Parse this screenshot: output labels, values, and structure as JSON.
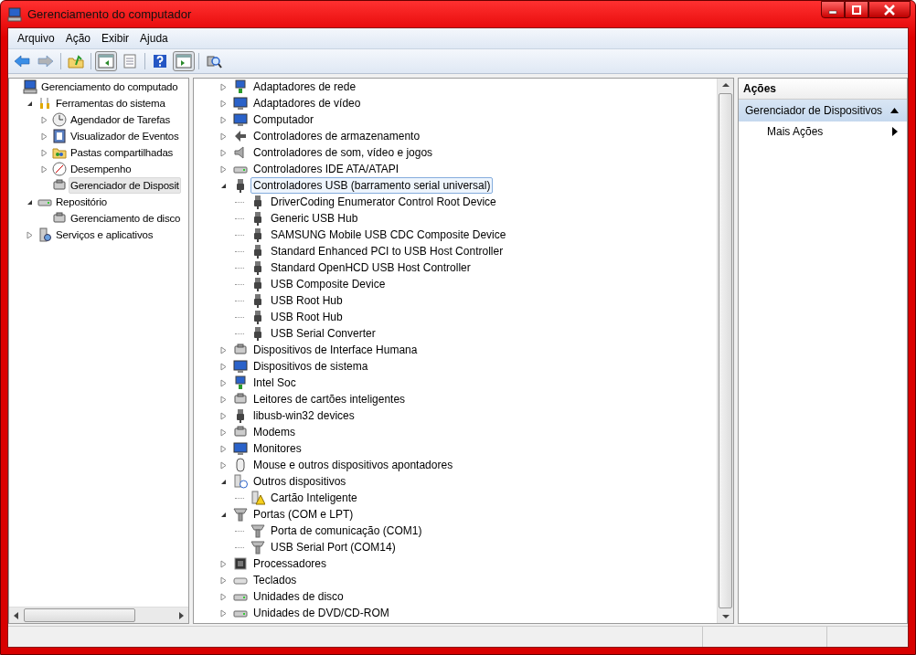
{
  "window": {
    "title": "Gerenciamento do computador"
  },
  "menu": [
    {
      "label": "Arquivo"
    },
    {
      "label": "Ação"
    },
    {
      "label": "Exibir"
    },
    {
      "label": "Ajuda"
    }
  ],
  "toolbar": [
    {
      "kind": "back",
      "disabled": false,
      "pressed": false
    },
    {
      "kind": "forward",
      "disabled": true,
      "pressed": false
    },
    {
      "kind": "up",
      "disabled": false,
      "pressed": false
    },
    {
      "kind": "tree-toggle",
      "disabled": false,
      "pressed": true
    },
    {
      "kind": "properties",
      "disabled": false,
      "pressed": false
    },
    {
      "kind": "help",
      "disabled": false,
      "pressed": false
    },
    {
      "kind": "pane-toggle",
      "disabled": false,
      "pressed": true
    },
    {
      "kind": "scan",
      "disabled": false,
      "pressed": false
    }
  ],
  "console_tree": [
    {
      "label": "Gerenciamento do computado",
      "kind": "computer",
      "selected": false,
      "children": [
        {
          "label": "Ferramentas do sistema",
          "kind": "tools",
          "expanded": true,
          "selected": false,
          "children": [
            {
              "label": "Agendador de Tarefas",
              "kind": "clock",
              "expanded": false,
              "selected": false
            },
            {
              "label": "Visualizador de Eventos",
              "kind": "log",
              "expanded": false,
              "selected": false
            },
            {
              "label": "Pastas compartilhadas",
              "kind": "folder",
              "expanded": false,
              "selected": false
            },
            {
              "label": "Desempenho",
              "kind": "gauge",
              "expanded": false,
              "selected": false
            },
            {
              "label": "Gerenciador de Disposit",
              "kind": "device",
              "selected": true
            }
          ]
        },
        {
          "label": "Repositório",
          "kind": "drive",
          "expanded": true,
          "selected": false,
          "children": [
            {
              "label": "Gerenciamento de disco",
              "kind": "device",
              "selected": false
            }
          ]
        },
        {
          "label": "Serviços e aplicativos",
          "kind": "services",
          "expanded": false,
          "selected": false
        }
      ]
    }
  ],
  "device_tree": [
    {
      "label": "Adaptadores de rede",
      "kind": "network",
      "expanded": false,
      "selected": false
    },
    {
      "label": "Adaptadores de vídeo",
      "kind": "monitor",
      "expanded": false,
      "selected": false
    },
    {
      "label": "Computador",
      "kind": "monitor",
      "expanded": false,
      "selected": false
    },
    {
      "label": "Controladores de armazenamento",
      "kind": "storage",
      "expanded": false,
      "selected": false
    },
    {
      "label": "Controladores de som, vídeo e jogos",
      "kind": "speaker",
      "expanded": false,
      "selected": false
    },
    {
      "label": "Controladores IDE ATA/ATAPI",
      "kind": "drive",
      "expanded": false,
      "selected": false
    },
    {
      "label": "Controladores USB (barramento serial universal)",
      "kind": "usb",
      "expanded": true,
      "selected": true,
      "children": [
        {
          "label": "DriverCoding Enumerator Control Root Device",
          "kind": "usb",
          "selected": false
        },
        {
          "label": "Generic USB Hub",
          "kind": "usb",
          "selected": false
        },
        {
          "label": "SAMSUNG Mobile USB CDC Composite Device",
          "kind": "usb",
          "selected": false
        },
        {
          "label": "Standard Enhanced PCI to USB Host Controller",
          "kind": "usb",
          "selected": false
        },
        {
          "label": "Standard OpenHCD USB Host Controller",
          "kind": "usb",
          "selected": false
        },
        {
          "label": "USB Composite Device",
          "kind": "usb",
          "selected": false
        },
        {
          "label": "USB Root Hub",
          "kind": "usb",
          "selected": false
        },
        {
          "label": "USB Root Hub",
          "kind": "usb",
          "selected": false
        },
        {
          "label": "USB Serial Converter",
          "kind": "usb",
          "selected": false
        }
      ]
    },
    {
      "label": "Dispositivos de Interface Humana",
      "kind": "device",
      "expanded": false,
      "selected": false
    },
    {
      "label": "Dispositivos de sistema",
      "kind": "monitor",
      "expanded": false,
      "selected": false
    },
    {
      "label": "Intel Soc",
      "kind": "network",
      "expanded": false,
      "selected": false
    },
    {
      "label": "Leitores de cartões inteligentes",
      "kind": "device",
      "expanded": false,
      "selected": false
    },
    {
      "label": "libusb-win32 devices",
      "kind": "usb",
      "expanded": false,
      "selected": false
    },
    {
      "label": "Modems",
      "kind": "device",
      "expanded": false,
      "selected": false
    },
    {
      "label": "Monitores",
      "kind": "monitor",
      "expanded": false,
      "selected": false
    },
    {
      "label": "Mouse e outros dispositivos apontadores",
      "kind": "mouse",
      "expanded": false,
      "selected": false
    },
    {
      "label": "Outros dispositivos",
      "kind": "unknown",
      "expanded": true,
      "selected": false,
      "children": [
        {
          "label": "Cartão Inteligente",
          "kind": "warning",
          "selected": false
        }
      ]
    },
    {
      "label": "Portas (COM e LPT)",
      "kind": "port",
      "expanded": true,
      "selected": false,
      "children": [
        {
          "label": "Porta de comunicação (COM1)",
          "kind": "port",
          "selected": false
        },
        {
          "label": "USB Serial Port (COM14)",
          "kind": "port",
          "selected": false
        }
      ]
    },
    {
      "label": "Processadores",
      "kind": "chip",
      "expanded": false,
      "selected": false
    },
    {
      "label": "Teclados",
      "kind": "keyboard",
      "expanded": false,
      "selected": false
    },
    {
      "label": "Unidades de disco",
      "kind": "drive",
      "expanded": false,
      "selected": false
    },
    {
      "label": "Unidades de DVD/CD-ROM",
      "kind": "drive",
      "expanded": false,
      "selected": false
    }
  ],
  "actions": {
    "title": "Ações",
    "section": {
      "label": "Gerenciador de Dispositivos",
      "expanded": true
    },
    "items": [
      {
        "label": "Mais Ações",
        "submenu": true
      }
    ]
  }
}
